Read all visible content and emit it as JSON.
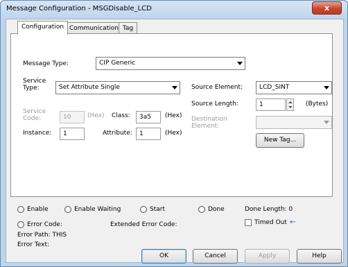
{
  "window": {
    "title": "Message Configuration - MSGDisable_LCD",
    "close_glyph": "x"
  },
  "tabs": [
    {
      "label": "Configuration",
      "active": true
    },
    {
      "label": "Communication",
      "active": false
    },
    {
      "label": "Tag",
      "active": false
    }
  ],
  "config": {
    "message_type_label": "Message Type:",
    "message_type_value": "CIP Generic",
    "service_type_label_1": "Service",
    "service_type_label_2": "Type:",
    "service_type_value": "Set Attribute Single",
    "service_code_label_1": "Service",
    "service_code_label_2": "Code:",
    "service_code_value": "10",
    "service_code_unit": "(Hex)",
    "class_label": "Class:",
    "class_value": "3a5",
    "class_unit": "(Hex)",
    "instance_label": "Instance:",
    "instance_value": "1",
    "attribute_label": "Attribute:",
    "attribute_value": "1",
    "attribute_unit": "(Hex)",
    "source_element_label": "Source Element:",
    "source_element_value": "LCD_SINT",
    "source_length_label": "Source Length:",
    "source_length_value": "1",
    "source_length_unit": "(Bytes)",
    "destination_label_1": "Destination",
    "destination_label_2": "Element:",
    "destination_value": "",
    "new_tag_button": "New Tag..."
  },
  "status": {
    "enable": "Enable",
    "enable_waiting": "Enable Waiting",
    "start": "Start",
    "done": "Done",
    "done_length": "Done Length: 0",
    "error_code": "Error Code:",
    "extended_error_code": "Extended Error Code:",
    "timed_out": "Timed Out",
    "timed_out_arrow": "←",
    "error_path": "Error Path: THIS",
    "error_text": "Error Text:"
  },
  "buttons": {
    "ok": "OK",
    "cancel": "Cancel",
    "apply": "Apply",
    "help": "Help"
  }
}
